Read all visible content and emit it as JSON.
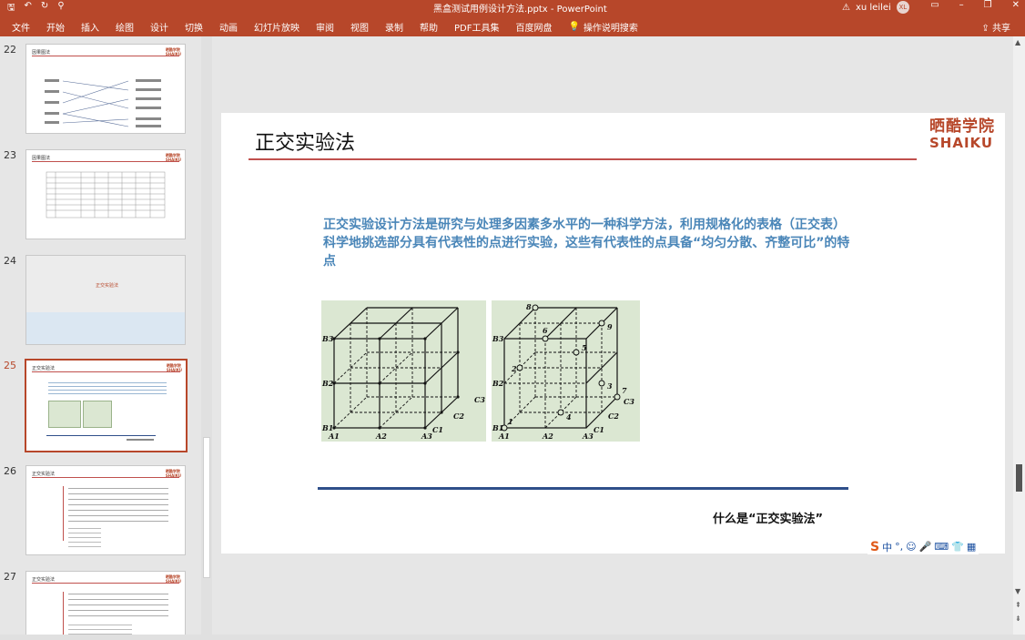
{
  "app": {
    "title": "黑盒测试用例设计方法.pptx - PowerPoint",
    "user_name": "xu leilei",
    "user_initials": "XL"
  },
  "quick_access": [
    "save-icon",
    "undo-icon",
    "redo-icon",
    "present-icon"
  ],
  "ribbon": {
    "tabs": [
      "文件",
      "开始",
      "插入",
      "绘图",
      "设计",
      "切换",
      "动画",
      "幻灯片放映",
      "审阅",
      "视图",
      "录制",
      "帮助",
      "PDF工具集",
      "百度网盘"
    ],
    "tell_me": "操作说明搜索",
    "share": "共享"
  },
  "thumbnails": [
    {
      "num": "22",
      "title": "因果图法"
    },
    {
      "num": "23",
      "title": "因果图法"
    },
    {
      "num": "24",
      "title": "正交实验法"
    },
    {
      "num": "25",
      "title": "正交实验法",
      "selected": true
    },
    {
      "num": "26",
      "title": "正交实验法"
    },
    {
      "num": "27",
      "title": "正交实验法"
    }
  ],
  "slide": {
    "title": "正交实验法",
    "logo_cn": "晒酷学院",
    "logo_en": "SHAIKU",
    "body": "正交实验设计方法是研究与处理多因素多水平的一种科学方法，利用规格化的表格（正交表）科学地挑选部分具有代表性的点进行实验，这些有代表性的点具备“均匀分散、齐整可比”的特点",
    "caption": "什么是“正交实验法”",
    "figure1_labels": {
      "b3": "B3",
      "b2": "B2",
      "b1": "B1",
      "a1": "A1",
      "a2": "A2",
      "a3": "A3",
      "c1": "C1",
      "c2": "C2",
      "c3": "C3"
    },
    "figure2_labels": {
      "b3": "B3",
      "b2": "B2",
      "b1": "B1",
      "a1": "A1",
      "a2": "A2",
      "a3": "A3",
      "c1": "C1",
      "c2": "C2",
      "c3": "C3",
      "p1": "1",
      "p2": "2",
      "p3": "3",
      "p4": "4",
      "p5": "5",
      "p6": "6",
      "p7": "7",
      "p8": "8",
      "p9": "9"
    }
  },
  "ime": {
    "s": "S",
    "lang": "中",
    "punct": "°,"
  },
  "colors": {
    "accent": "#b7472a",
    "text_blue": "#4a86b8",
    "rule_blue": "#2f4f8a",
    "thumb_bg": "#dbe7d2"
  }
}
